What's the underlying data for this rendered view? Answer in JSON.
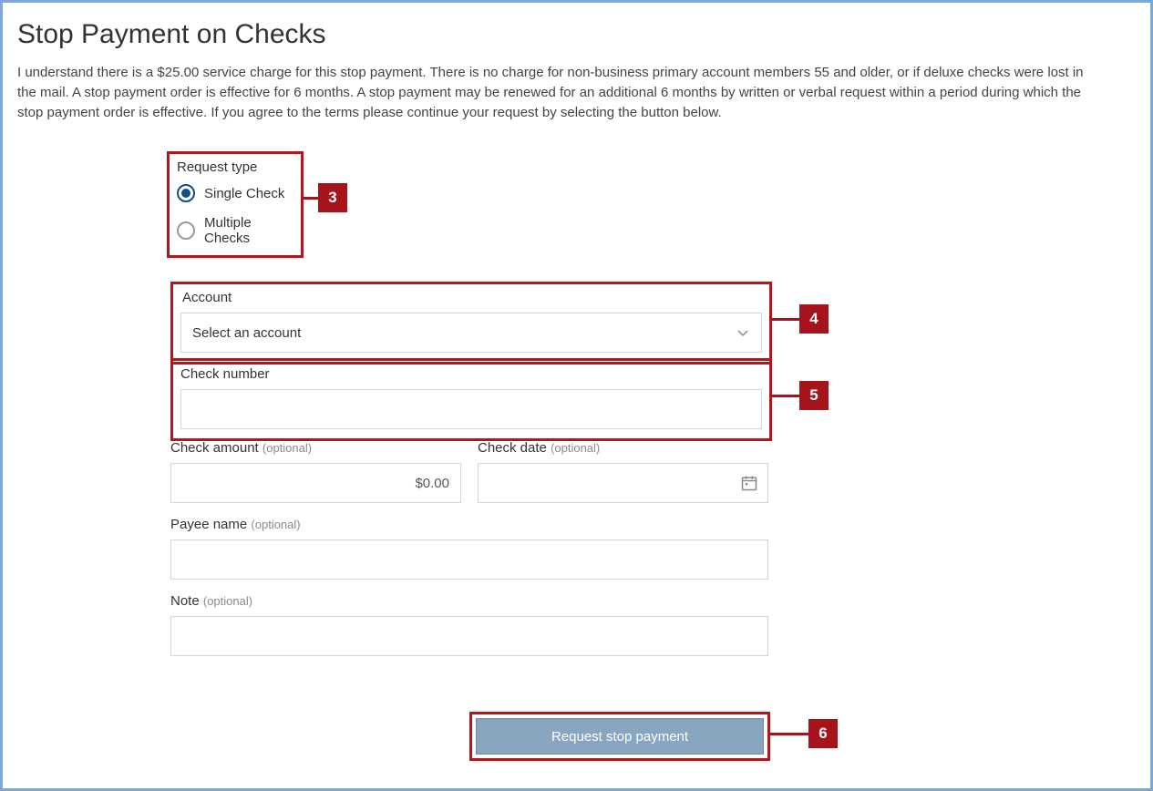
{
  "page": {
    "title": "Stop Payment on Checks",
    "intro": "I understand there is a $25.00 service charge for this stop payment. There is no charge for non-business primary account members 55 and older, or if deluxe checks were lost in the mail. A stop payment order is effective for 6 months. A stop payment may be renewed for an additional 6 months by written or verbal request within a period during which the stop payment order is effective. If you agree to the terms please continue your request by selecting the button below."
  },
  "callouts": {
    "request_type": "3",
    "account": "4",
    "check_number": "5",
    "submit": "6"
  },
  "request_type": {
    "label": "Request type",
    "options": {
      "single": "Single Check",
      "multiple": "Multiple Checks"
    },
    "selected": "single"
  },
  "account": {
    "label": "Account",
    "placeholder": "Select an account"
  },
  "check_number": {
    "label": "Check number",
    "value": ""
  },
  "check_amount": {
    "label": "Check amount",
    "optional": "(optional)",
    "value": "$0.00"
  },
  "check_date": {
    "label": "Check date",
    "optional": "(optional)",
    "value": ""
  },
  "payee": {
    "label": "Payee name",
    "optional": "(optional)",
    "value": ""
  },
  "note": {
    "label": "Note",
    "optional": "(optional)",
    "value": ""
  },
  "submit": {
    "label": "Request stop payment"
  }
}
